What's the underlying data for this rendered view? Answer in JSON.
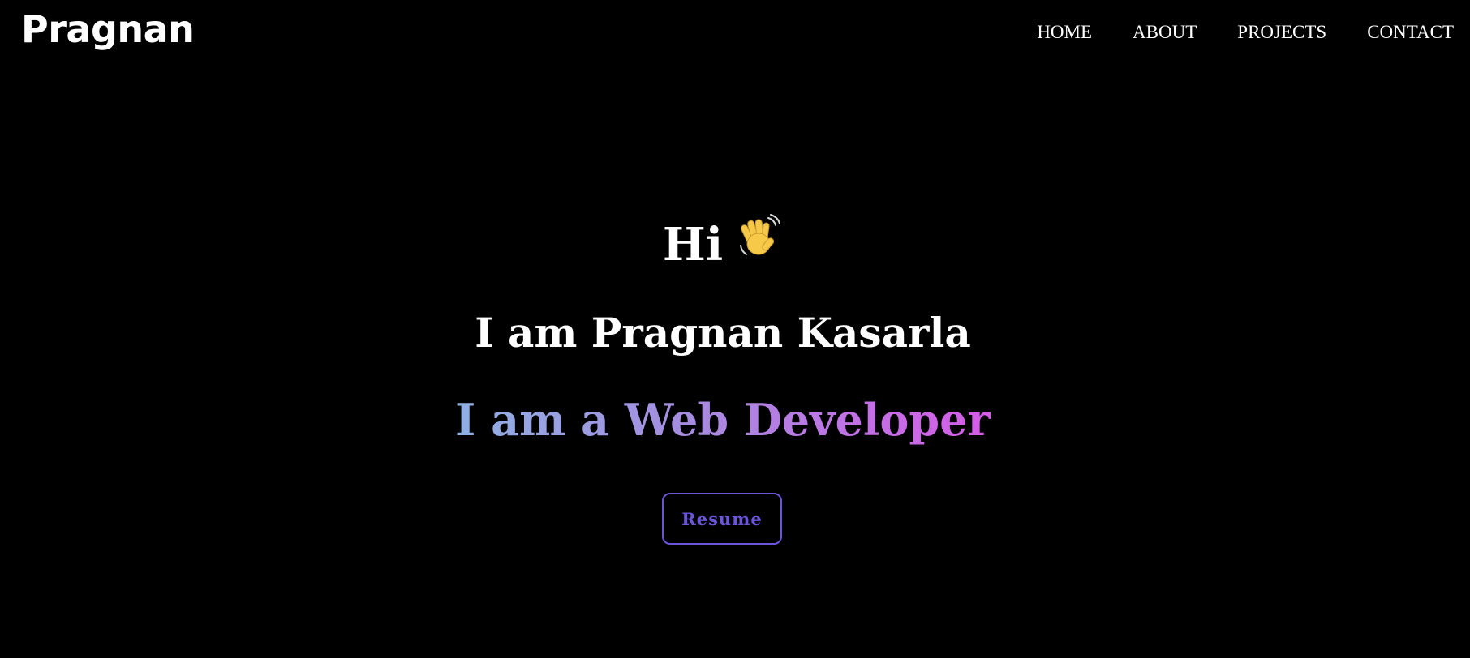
{
  "header": {
    "logo": "Pragnan",
    "nav": [
      {
        "label": "HOME"
      },
      {
        "label": "ABOUT"
      },
      {
        "label": "PROJECTS"
      },
      {
        "label": "CONTACT"
      }
    ]
  },
  "hero": {
    "greeting": "Hi",
    "greeting_icon": "waving-hand-icon",
    "intro": "I am Pragnan Kasarla",
    "role": "I am a Web Developer",
    "resume_label": "Resume"
  },
  "colors": {
    "background": "#000000",
    "text": "#ffffff",
    "accent": "#6b55d9",
    "gradient_start": "#8fb0e3",
    "gradient_mid": "#a78be0",
    "gradient_end": "#d65ce8"
  }
}
